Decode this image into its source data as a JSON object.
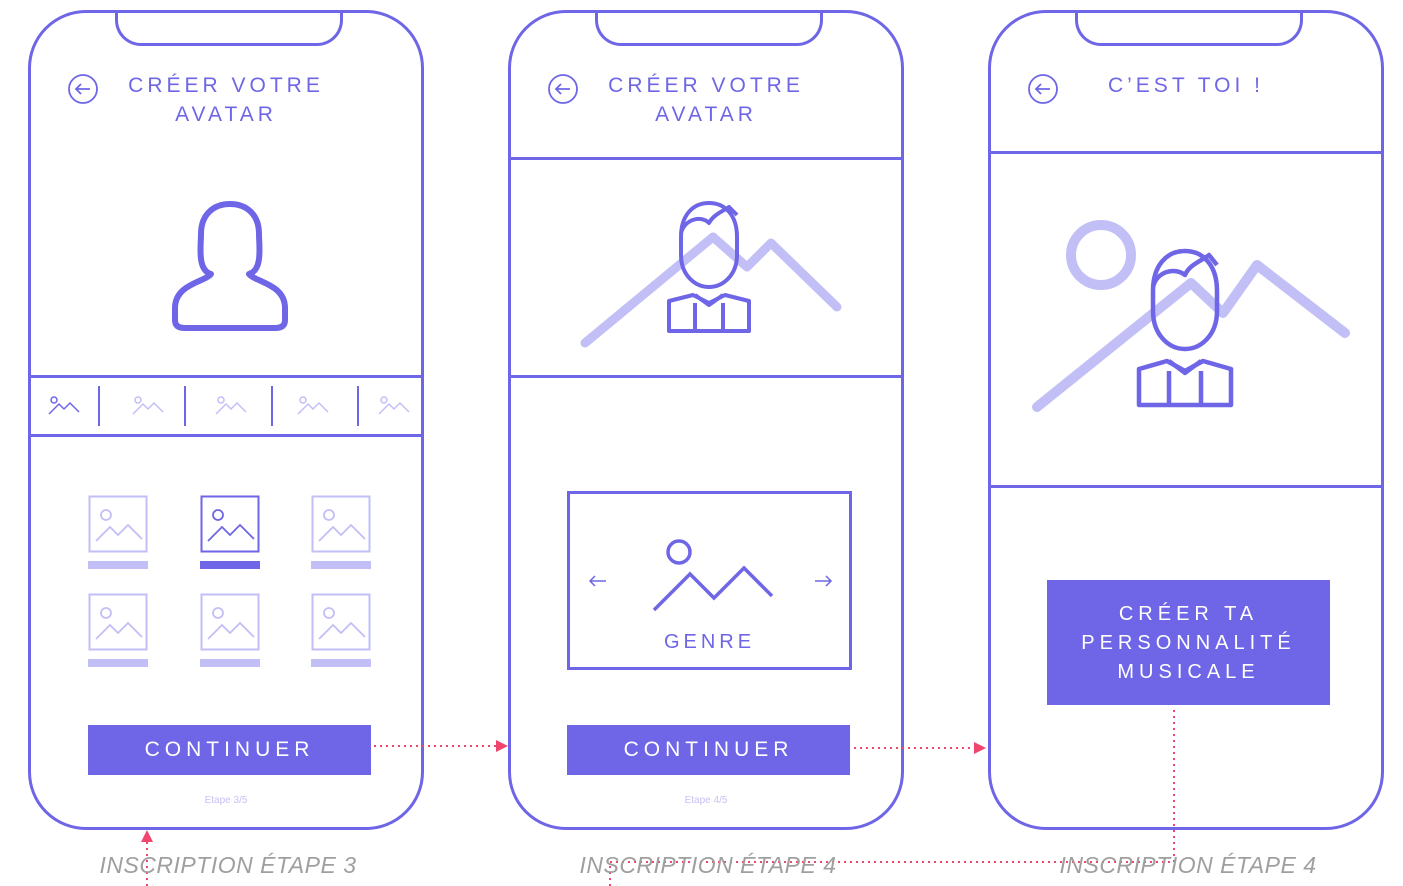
{
  "screens": [
    {
      "title": "CRÉER VOTRE AVATAR",
      "button": "CONTINUER",
      "step": "Etape 3/5",
      "caption": "INSCRIPTION ÉTAPE 3"
    },
    {
      "title": "CRÉER VOTRE AVATAR",
      "button": "CONTINUER",
      "step": "Etape 4/5",
      "caption": "INSCRIPTION ÉTAPE 4",
      "selector_label": "GENRE"
    },
    {
      "title": "C’EST TOI !",
      "button": "CRÉER TA PERSONNALITÉ MUSICALE",
      "caption": "INSCRIPTION ÉTAPE 4"
    }
  ],
  "icons": {
    "back": "arrow-left-circle-icon",
    "avatar": "user-icon",
    "placeholder": "image-icon",
    "prev": "arrow-left-icon",
    "next": "arrow-right-icon"
  },
  "colors": {
    "primary": "#6e66e6",
    "light": "#c2bff7",
    "flow": "#f2456e",
    "caption": "#9f9f9f"
  }
}
